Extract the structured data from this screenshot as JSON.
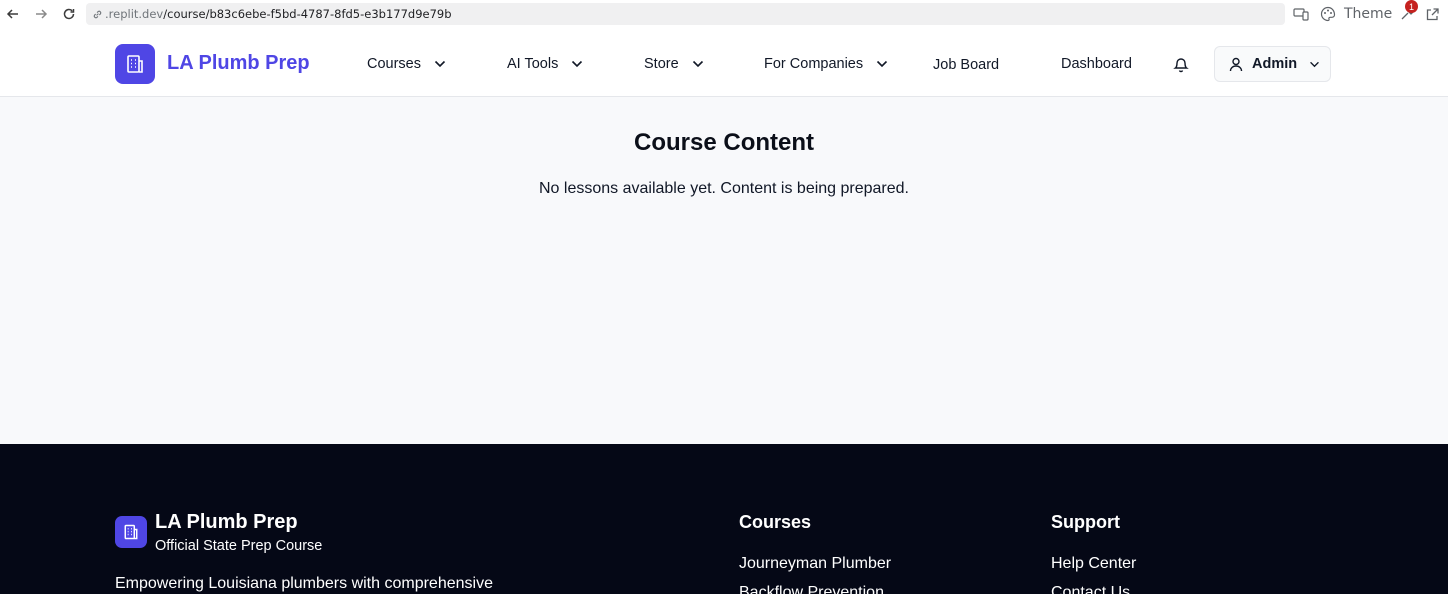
{
  "browser": {
    "url_host": ".replit.dev",
    "url_path": "/course/b83c6ebe-f5bd-4787-8fd5-e3b177d9e79b",
    "theme_label": "Theme",
    "badge_count": "1"
  },
  "header": {
    "brand": "LA Plumb Prep",
    "nav": {
      "courses": "Courses",
      "ai_tools": "AI Tools",
      "store": "Store",
      "for_companies": "For Companies",
      "job_board": "Job Board",
      "dashboard": "Dashboard"
    },
    "user_menu_label": "Admin"
  },
  "main": {
    "title": "Course Content",
    "message": "No lessons available yet. Content is being prepared."
  },
  "footer": {
    "brand": "LA Plumb Prep",
    "tagline": "Official State Prep Course",
    "description": "Empowering Louisiana plumbers with comprehensive",
    "courses_heading": "Courses",
    "courses_links": [
      "Journeyman Plumber",
      "Backflow Prevention"
    ],
    "support_heading": "Support",
    "support_links": [
      "Help Center",
      "Contact Us"
    ]
  },
  "colors": {
    "brand": "#4f46e5",
    "footer_bg": "#050816",
    "main_bg": "#f8f9fb"
  }
}
